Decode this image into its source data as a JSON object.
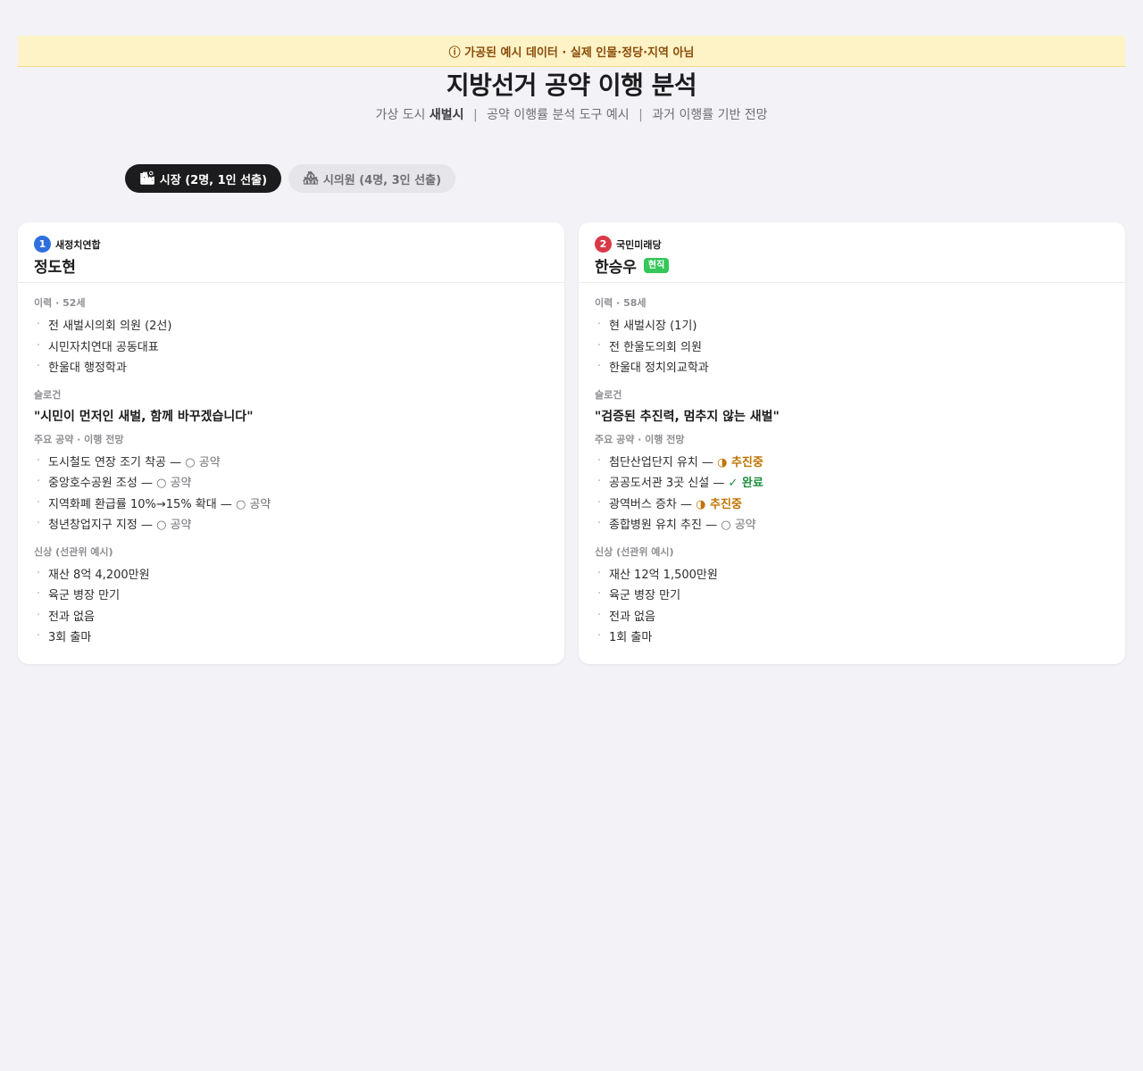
{
  "notice": "ⓘ 가공된 예시 데이터 · 실제 인물·정당·지역 아님",
  "header": {
    "title": "지방선거 공약 이행 분석",
    "subtitle_prefix": "가상 도시",
    "city": "새벌시",
    "sep1": "|",
    "subtitle_mid": "공약 이행률 분석 도구 예시",
    "sep2": "|",
    "subtitle_end": "과거 이행률 기반 전망"
  },
  "tabs": [
    {
      "icon": "🏙",
      "label": "시장 (2명, 1인 선출)",
      "active": true
    },
    {
      "icon": "🏘",
      "label": "시의원 (4명, 3인 선출)",
      "active": false
    }
  ],
  "candidates": [
    {
      "number": "1",
      "party": "새정치연합",
      "name": "정도현",
      "badge": "",
      "career_label": "이력 · 52세",
      "career": [
        "전 새벌시의회 의원 (2선)",
        "시민자치연대 공동대표",
        "한울대 행정학과"
      ],
      "slogan_label": "슬로건",
      "slogan": "\"시민이 먼저인 새벌, 함께 바꾸겠습니다\"",
      "pledges_label": "주요 공약 · 이행 전망",
      "pledges": [
        {
          "text": "도시철도 연장 조기 착공 —",
          "status": "○ 공약"
        },
        {
          "text": "중앙호수공원 조성 —",
          "status": "○ 공약"
        },
        {
          "text": "지역화폐 환급률 10%→15% 확대 —",
          "status": "○ 공약"
        },
        {
          "text": "청년창업지구 지정 —",
          "status": "○ 공약"
        }
      ],
      "profile_label": "신상 (선관위 예시)",
      "profile": [
        "재산 8억 4,200만원",
        "육군 병장 만기",
        "전과 없음",
        "3회 출마"
      ]
    },
    {
      "number": "2",
      "party": "국민미래당",
      "name": "한승우",
      "badge": "현직",
      "career_label": "이력 · 58세",
      "career": [
        "현 새벌시장 (1기)",
        "전 한울도의회 의원",
        "한울대 정치외교학과"
      ],
      "slogan_label": "슬로건",
      "slogan": "\"검증된 추진력, 멈추지 않는 새벌\"",
      "pledges_label": "주요 공약 · 이행 전망",
      "pledges": [
        {
          "text": "첨단산업단지 유치 —",
          "status": "◑ 추진중"
        },
        {
          "text": "공공도서관 3곳 신설 —",
          "status": "✓ 완료"
        },
        {
          "text": "광역버스 증차 —",
          "status": "◑ 추진중"
        },
        {
          "text": "종합병원 유치 추진 —",
          "status": "○ 공약"
        }
      ],
      "profile_label": "신상 (선관위 예시)",
      "profile": [
        "재산 12억 1,500만원",
        "육군 병장 만기",
        "전과 없음",
        "1회 출마"
      ]
    }
  ],
  "colors": {
    "pledge": "#6e6e73",
    "progress": "#c07400",
    "done": "#1e8e3e",
    "party1": "#2f6fde",
    "party2": "#d93a48"
  }
}
